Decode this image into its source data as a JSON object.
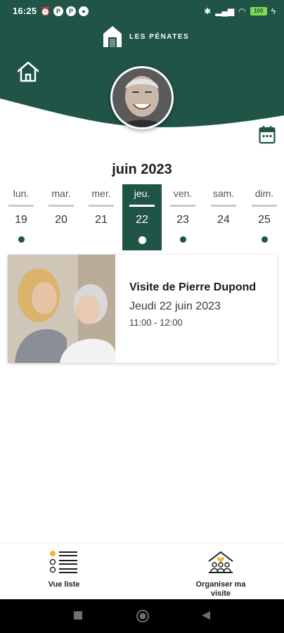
{
  "status_bar": {
    "time": "16:25",
    "left_icons": [
      "alarm-icon",
      "app-notification-icon",
      "app-notification-icon",
      "app-notification-icon"
    ],
    "right_icons": [
      "bluetooth-icon",
      "signal-icon",
      "wifi-icon",
      "battery-icon"
    ],
    "battery_label": "100"
  },
  "header": {
    "brand_name": "LES PÉNATES",
    "brand_color": "#1f5447"
  },
  "calendar": {
    "month": "juin 2023",
    "days": [
      {
        "name": "lun.",
        "number": "19",
        "has_event": true,
        "selected": false
      },
      {
        "name": "mar.",
        "number": "20",
        "has_event": false,
        "selected": false
      },
      {
        "name": "mer.",
        "number": "21",
        "has_event": false,
        "selected": false
      },
      {
        "name": "jeu.",
        "number": "22",
        "has_event": true,
        "selected": true
      },
      {
        "name": "ven.",
        "number": "23",
        "has_event": true,
        "selected": false
      },
      {
        "name": "sam.",
        "number": "24",
        "has_event": false,
        "selected": false
      },
      {
        "name": "dim.",
        "number": "25",
        "has_event": true,
        "selected": false
      }
    ]
  },
  "visit": {
    "title": "Visite de Pierre Dupond",
    "date": "Jeudi 22 juin 2023",
    "time": "11:00 - 12:00"
  },
  "bottom_nav": {
    "list_view_label": "Vue liste",
    "organize_label_line1": "Organiser ma",
    "organize_label_line2": "visite"
  }
}
